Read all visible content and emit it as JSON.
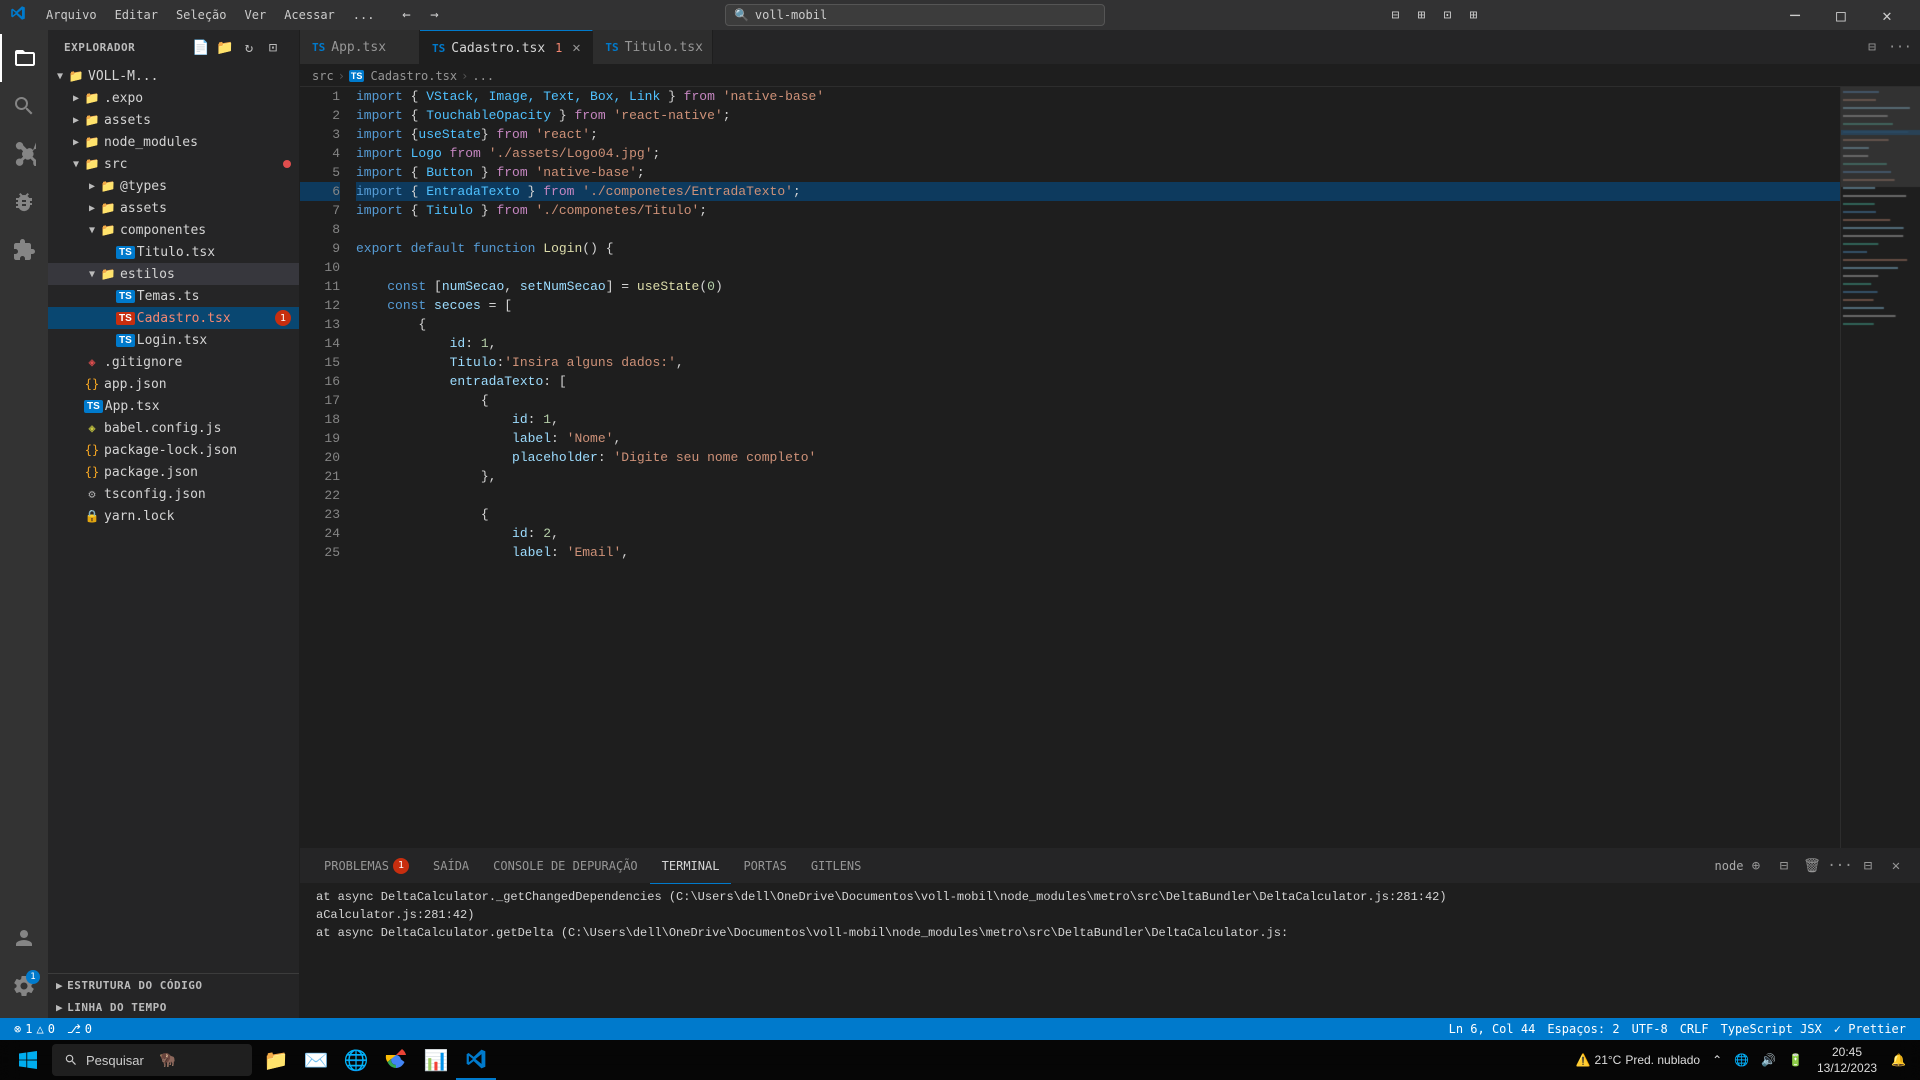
{
  "titlebar": {
    "menus": [
      "Arquivo",
      "Editar",
      "Seleção",
      "Ver",
      "Acessar",
      "..."
    ],
    "nav_back": "←",
    "nav_forward": "→",
    "search_placeholder": "voll-mobil",
    "layout_btns": [
      "⊟",
      "⊞",
      "⊡",
      "⊞"
    ],
    "min": "─",
    "max": "□",
    "close": "✕"
  },
  "sidebar": {
    "title": "EXPLORADOR",
    "root": "VOLL-M...",
    "actions": [
      "📄+",
      "📁+",
      "↻",
      "⊡"
    ],
    "tree": [
      {
        "id": "expo",
        "label": ".expo",
        "type": "folder",
        "collapsed": true,
        "indent": 1,
        "icon": "▶"
      },
      {
        "id": "assets",
        "label": "assets",
        "type": "folder",
        "collapsed": true,
        "indent": 1,
        "icon": "▶"
      },
      {
        "id": "node_modules",
        "label": "node_modules",
        "type": "folder",
        "collapsed": true,
        "indent": 1,
        "icon": "▶"
      },
      {
        "id": "src",
        "label": "src",
        "type": "folder",
        "collapsed": false,
        "indent": 1,
        "icon": "▼",
        "dot": "red"
      },
      {
        "id": "types",
        "label": "@types",
        "type": "folder",
        "collapsed": true,
        "indent": 2,
        "icon": "▶"
      },
      {
        "id": "assets2",
        "label": "assets",
        "type": "folder",
        "collapsed": true,
        "indent": 2,
        "icon": "▶"
      },
      {
        "id": "componentes",
        "label": "componentes",
        "type": "folder",
        "collapsed": false,
        "indent": 2,
        "icon": "▼"
      },
      {
        "id": "Titulo",
        "label": "Titulo.tsx",
        "type": "ts",
        "indent": 3,
        "icon": "TS"
      },
      {
        "id": "estilos",
        "label": "estilos",
        "type": "folder",
        "collapsed": false,
        "indent": 2,
        "icon": "▼",
        "selected": true
      },
      {
        "id": "Temas",
        "label": "Temas.ts",
        "type": "ts",
        "indent": 3,
        "icon": "TS"
      },
      {
        "id": "Cadastro",
        "label": "Cadastro.tsx",
        "type": "ts",
        "indent": 3,
        "icon": "TS",
        "badge": "1",
        "active": true,
        "color": "red"
      },
      {
        "id": "Login",
        "label": "Login.tsx",
        "type": "ts",
        "indent": 3,
        "icon": "TS"
      },
      {
        "id": "gitignore",
        "label": ".gitignore",
        "type": "git",
        "indent": 1,
        "icon": "◈"
      },
      {
        "id": "appjson",
        "label": "app.json",
        "type": "json",
        "indent": 1,
        "icon": "{}"
      },
      {
        "id": "Apptsx",
        "label": "App.tsx",
        "type": "ts",
        "indent": 1,
        "icon": "TS"
      },
      {
        "id": "babel",
        "label": "babel.config.js",
        "type": "js",
        "indent": 1,
        "icon": "◈"
      },
      {
        "id": "pkglock",
        "label": "package-lock.json",
        "type": "json",
        "indent": 1,
        "icon": "{}"
      },
      {
        "id": "pkg",
        "label": "package.json",
        "type": "json",
        "indent": 1,
        "icon": "{}"
      },
      {
        "id": "tsconfig",
        "label": "tsconfig.json",
        "type": "json",
        "indent": 1,
        "icon": "⚙"
      },
      {
        "id": "yarn",
        "label": "yarn.lock",
        "type": "lock",
        "indent": 1,
        "icon": "🔒"
      }
    ],
    "sections": [
      {
        "id": "estrutura",
        "label": "ESTRUTURA DO CÓDIGO",
        "collapsed": true,
        "icon": "▶"
      },
      {
        "id": "timeline",
        "label": "LINHA DO TEMPO",
        "collapsed": true,
        "icon": "▶"
      }
    ]
  },
  "tabs": [
    {
      "id": "app",
      "label": "App.tsx",
      "icon": "TS",
      "active": false,
      "modified": false
    },
    {
      "id": "cadastro",
      "label": "Cadastro.tsx",
      "icon": "TS",
      "active": true,
      "modified": true,
      "badge": "1"
    },
    {
      "id": "titulo",
      "label": "Titulo.tsx",
      "icon": "TS",
      "active": false,
      "modified": false
    }
  ],
  "breadcrumb": {
    "parts": [
      "src",
      ">",
      "TS",
      "Cadastro.tsx",
      ">",
      "..."
    ]
  },
  "code": {
    "lines": [
      {
        "num": 1,
        "tokens": [
          {
            "t": "kw",
            "v": "import"
          },
          {
            "t": "plain",
            "v": " { "
          },
          {
            "t": "import-mod",
            "v": "VStack, Image, Text, Box, Link"
          },
          {
            "t": "plain",
            "v": " } "
          },
          {
            "t": "kw2",
            "v": "from"
          },
          {
            "t": "plain",
            "v": " "
          },
          {
            "t": "str",
            "v": "'native-base'"
          }
        ]
      },
      {
        "num": 2,
        "tokens": [
          {
            "t": "kw",
            "v": "import"
          },
          {
            "t": "plain",
            "v": " { "
          },
          {
            "t": "import-mod",
            "v": "TouchableOpacity"
          },
          {
            "t": "plain",
            "v": " } "
          },
          {
            "t": "kw2",
            "v": "from"
          },
          {
            "t": "plain",
            "v": " "
          },
          {
            "t": "str",
            "v": "'react-native'"
          },
          {
            "t": "plain",
            "v": ";"
          }
        ]
      },
      {
        "num": 3,
        "tokens": [
          {
            "t": "kw",
            "v": "import"
          },
          {
            "t": "plain",
            "v": " {"
          },
          {
            "t": "import-mod",
            "v": "useState"
          },
          {
            "t": "plain",
            "v": "} "
          },
          {
            "t": "kw2",
            "v": "from"
          },
          {
            "t": "plain",
            "v": " "
          },
          {
            "t": "str",
            "v": "'react'"
          },
          {
            "t": "plain",
            "v": ";"
          }
        ]
      },
      {
        "num": 4,
        "tokens": [
          {
            "t": "kw",
            "v": "import"
          },
          {
            "t": "plain",
            "v": " "
          },
          {
            "t": "import-mod",
            "v": "Logo"
          },
          {
            "t": "plain",
            "v": " "
          },
          {
            "t": "kw2",
            "v": "from"
          },
          {
            "t": "plain",
            "v": " "
          },
          {
            "t": "str",
            "v": "'./assets/Logo04.jpg'"
          },
          {
            "t": "plain",
            "v": ";"
          }
        ]
      },
      {
        "num": 5,
        "tokens": [
          {
            "t": "kw",
            "v": "import"
          },
          {
            "t": "plain",
            "v": " { "
          },
          {
            "t": "import-mod",
            "v": "Button"
          },
          {
            "t": "plain",
            "v": " } "
          },
          {
            "t": "kw2",
            "v": "from"
          },
          {
            "t": "plain",
            "v": " "
          },
          {
            "t": "str",
            "v": "'native-base'"
          },
          {
            "t": "plain",
            "v": ";"
          }
        ]
      },
      {
        "num": 6,
        "tokens": [
          {
            "t": "kw",
            "v": "import"
          },
          {
            "t": "plain",
            "v": " { "
          },
          {
            "t": "import-mod",
            "v": "EntradaTexto"
          },
          {
            "t": "plain",
            "v": " } "
          },
          {
            "t": "kw2",
            "v": "from"
          },
          {
            "t": "plain",
            "v": " "
          },
          {
            "t": "str",
            "v": "'./componetes/EntradaTexto'"
          },
          {
            "t": "plain",
            "v": ";"
          }
        ],
        "highlighted": true
      },
      {
        "num": 7,
        "tokens": [
          {
            "t": "kw",
            "v": "import"
          },
          {
            "t": "plain",
            "v": " { "
          },
          {
            "t": "import-mod",
            "v": "Titulo"
          },
          {
            "t": "plain",
            "v": " } "
          },
          {
            "t": "kw2",
            "v": "from"
          },
          {
            "t": "plain",
            "v": " "
          },
          {
            "t": "str",
            "v": "'./componetes/Titulo'"
          },
          {
            "t": "plain",
            "v": ";"
          }
        ]
      },
      {
        "num": 8,
        "tokens": []
      },
      {
        "num": 9,
        "tokens": [
          {
            "t": "kw",
            "v": "export"
          },
          {
            "t": "plain",
            "v": " "
          },
          {
            "t": "kw",
            "v": "default"
          },
          {
            "t": "plain",
            "v": " "
          },
          {
            "t": "kw",
            "v": "function"
          },
          {
            "t": "plain",
            "v": " "
          },
          {
            "t": "fn",
            "v": "Login"
          },
          {
            "t": "plain",
            "v": "() {"
          }
        ]
      },
      {
        "num": 10,
        "tokens": []
      },
      {
        "num": 11,
        "tokens": [
          {
            "t": "plain",
            "v": "    "
          },
          {
            "t": "kw",
            "v": "const"
          },
          {
            "t": "plain",
            "v": " ["
          },
          {
            "t": "var",
            "v": "numSecao"
          },
          {
            "t": "plain",
            "v": ", "
          },
          {
            "t": "var",
            "v": "setNumSecao"
          },
          {
            "t": "plain",
            "v": "] = "
          },
          {
            "t": "fn",
            "v": "useState"
          },
          {
            "t": "plain",
            "v": "("
          },
          {
            "t": "num",
            "v": "0"
          },
          {
            "t": "plain",
            "v": ")"
          }
        ]
      },
      {
        "num": 12,
        "tokens": [
          {
            "t": "plain",
            "v": "    "
          },
          {
            "t": "kw",
            "v": "const"
          },
          {
            "t": "plain",
            "v": " "
          },
          {
            "t": "var",
            "v": "secoes"
          },
          {
            "t": "plain",
            "v": " = ["
          }
        ]
      },
      {
        "num": 13,
        "tokens": [
          {
            "t": "plain",
            "v": "        {"
          }
        ]
      },
      {
        "num": 14,
        "tokens": [
          {
            "t": "plain",
            "v": "            "
          },
          {
            "t": "prop",
            "v": "id"
          },
          {
            "t": "plain",
            "v": ": "
          },
          {
            "t": "num",
            "v": "1"
          },
          {
            "t": "plain",
            "v": ","
          }
        ]
      },
      {
        "num": 15,
        "tokens": [
          {
            "t": "plain",
            "v": "            "
          },
          {
            "t": "prop",
            "v": "Titulo"
          },
          {
            "t": "plain",
            "v": ":"
          },
          {
            "t": "str",
            "v": "'Insira alguns dados:'"
          },
          {
            "t": "plain",
            "v": ","
          }
        ]
      },
      {
        "num": 16,
        "tokens": [
          {
            "t": "plain",
            "v": "            "
          },
          {
            "t": "prop",
            "v": "entradaTexto"
          },
          {
            "t": "plain",
            "v": ": ["
          }
        ]
      },
      {
        "num": 17,
        "tokens": [
          {
            "t": "plain",
            "v": "                {"
          }
        ]
      },
      {
        "num": 18,
        "tokens": [
          {
            "t": "plain",
            "v": "                    "
          },
          {
            "t": "prop",
            "v": "id"
          },
          {
            "t": "plain",
            "v": ": "
          },
          {
            "t": "num",
            "v": "1"
          },
          {
            "t": "plain",
            "v": ","
          }
        ]
      },
      {
        "num": 19,
        "tokens": [
          {
            "t": "plain",
            "v": "                    "
          },
          {
            "t": "prop",
            "v": "label"
          },
          {
            "t": "plain",
            "v": ": "
          },
          {
            "t": "str",
            "v": "'Nome'"
          },
          {
            "t": "plain",
            "v": ","
          }
        ]
      },
      {
        "num": 20,
        "tokens": [
          {
            "t": "plain",
            "v": "                    "
          },
          {
            "t": "prop",
            "v": "placeholder"
          },
          {
            "t": "plain",
            "v": ": "
          },
          {
            "t": "str",
            "v": "'Digite seu nome completo'"
          }
        ]
      },
      {
        "num": 21,
        "tokens": [
          {
            "t": "plain",
            "v": "                },"
          }
        ]
      },
      {
        "num": 22,
        "tokens": []
      },
      {
        "num": 23,
        "tokens": [
          {
            "t": "plain",
            "v": "                {"
          }
        ]
      },
      {
        "num": 24,
        "tokens": [
          {
            "t": "plain",
            "v": "                    "
          },
          {
            "t": "prop",
            "v": "id"
          },
          {
            "t": "plain",
            "v": ": "
          },
          {
            "t": "num",
            "v": "2"
          },
          {
            "t": "plain",
            "v": ","
          }
        ]
      },
      {
        "num": 25,
        "tokens": [
          {
            "t": "plain",
            "v": "                    "
          },
          {
            "t": "prop",
            "v": "label"
          },
          {
            "t": "plain",
            "v": ": "
          },
          {
            "t": "str",
            "v": "'Email'"
          },
          {
            "t": "plain",
            "v": ","
          }
        ]
      }
    ],
    "total_lines": 25
  },
  "panel": {
    "tabs": [
      {
        "id": "problems",
        "label": "PROBLEMAS",
        "badge": "1"
      },
      {
        "id": "saida",
        "label": "SAÍDA"
      },
      {
        "id": "console",
        "label": "CONSOLE DE DEPURAÇÃO"
      },
      {
        "id": "terminal",
        "label": "TERMINAL",
        "active": true
      },
      {
        "id": "portas",
        "label": "PORTAS"
      },
      {
        "id": "gitlens",
        "label": "GITLENS"
      }
    ],
    "terminal_content": [
      "    at async DeltaCalculator._getChangedDependencies (C:\\Users\\dell\\OneDrive\\Documentos\\voll-mobil\\node_modules\\metro\\src\\DeltaBundler\\DeltaCalculator.js:281:42)",
      "aCalculator.js:281:42)",
      "    at async DeltaCalculator.getDelta (C:\\Users\\dell\\OneDrive\\Documentos\\voll-mobil\\node_modules\\metro\\src\\DeltaBundler\\DeltaCalculator.js:"
    ],
    "shell": "node"
  },
  "status": {
    "errors": "⊗ 1",
    "warnings": "△ 0",
    "git_branch": " 0",
    "ln_col": "Ln 6, Col 44",
    "spaces": "Espaços: 2",
    "encoding": "UTF-8",
    "eol": "CRLF",
    "lang": "TypeScript JSX",
    "formatter": "✓ Prettier"
  },
  "windows_taskbar": {
    "search_text": "Pesquisar",
    "apps": [
      "⊞",
      "📁",
      "✉",
      "🌐",
      "🟠",
      "🟦",
      "📊",
      "🔷"
    ],
    "time": "20:45",
    "date": "13/12/2023",
    "temp": "21°C",
    "weather": "Pred. nublado"
  }
}
